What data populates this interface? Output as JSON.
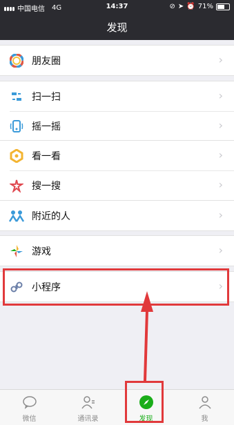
{
  "status": {
    "carrier": "中国电信",
    "network": "4G",
    "time": "14:37",
    "battery": "71%",
    "battery_level": 0.71
  },
  "header": {
    "title": "发现"
  },
  "groups": [
    {
      "items": [
        {
          "label": "朋友圈"
        }
      ]
    },
    {
      "items": [
        {
          "label": "扫一扫"
        },
        {
          "label": "摇一摇"
        }
      ]
    },
    {
      "items": [
        {
          "label": "看一看"
        },
        {
          "label": "搜一搜"
        }
      ]
    },
    {
      "items": [
        {
          "label": "附近的人"
        }
      ]
    },
    {
      "items": [
        {
          "label": "游戏"
        }
      ]
    },
    {
      "items": [
        {
          "label": "小程序"
        }
      ]
    }
  ],
  "tabs": [
    {
      "label": "微信",
      "icon": "chat-icon"
    },
    {
      "label": "通讯录",
      "icon": "contacts-icon"
    },
    {
      "label": "发现",
      "icon": "compass-icon",
      "active": true
    },
    {
      "label": "我",
      "icon": "person-icon"
    }
  ],
  "colors": {
    "header": "#2b2b30",
    "accent": "#1aad19",
    "highlight": "#e1393b"
  }
}
